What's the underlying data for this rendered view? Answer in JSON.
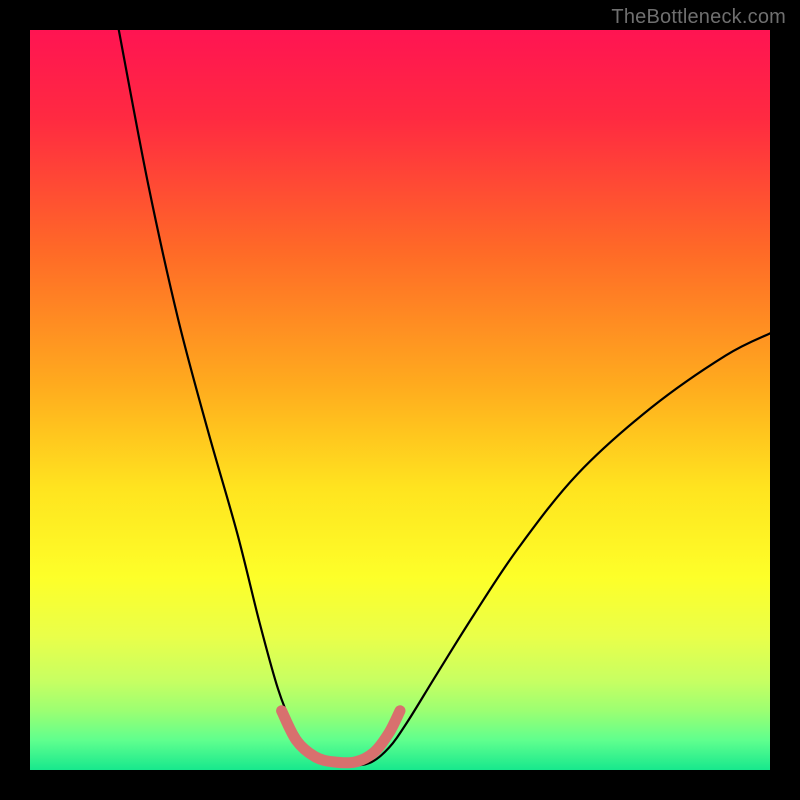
{
  "watermark": "TheBottleneck.com",
  "chart_data": {
    "type": "line",
    "title": "",
    "xlabel": "",
    "ylabel": "",
    "xlim": [
      0,
      100
    ],
    "ylim": [
      0,
      100
    ],
    "grid": false,
    "legend": false,
    "notes": "Background is a vertical color ramp from red (top) through orange/yellow to green (bottom). Two black curves descend from top-left and rise toward upper-right, meeting at a flat valley near the bottom. A short coral-pink line overlays the valley. Axes are unlabeled.",
    "background_gradient_stops": [
      {
        "offset": 0.0,
        "color": "#ff1452"
      },
      {
        "offset": 0.12,
        "color": "#ff2a41"
      },
      {
        "offset": 0.3,
        "color": "#ff6a27"
      },
      {
        "offset": 0.48,
        "color": "#ffab1e"
      },
      {
        "offset": 0.62,
        "color": "#ffe41f"
      },
      {
        "offset": 0.74,
        "color": "#fdff29"
      },
      {
        "offset": 0.82,
        "color": "#e9ff4a"
      },
      {
        "offset": 0.88,
        "color": "#c7ff62"
      },
      {
        "offset": 0.92,
        "color": "#9cff72"
      },
      {
        "offset": 0.96,
        "color": "#5fff8e"
      },
      {
        "offset": 1.0,
        "color": "#17e88d"
      }
    ],
    "series": [
      {
        "name": "left-curve",
        "values": [
          {
            "x": 12,
            "y": 100
          },
          {
            "x": 16,
            "y": 79
          },
          {
            "x": 20,
            "y": 61
          },
          {
            "x": 24,
            "y": 46
          },
          {
            "x": 28,
            "y": 32
          },
          {
            "x": 31,
            "y": 20
          },
          {
            "x": 33.5,
            "y": 11
          },
          {
            "x": 35.5,
            "y": 6
          },
          {
            "x": 37.5,
            "y": 3
          },
          {
            "x": 40,
            "y": 1
          }
        ]
      },
      {
        "name": "valley-floor",
        "values": [
          {
            "x": 40,
            "y": 1
          },
          {
            "x": 43,
            "y": 0.6
          },
          {
            "x": 46,
            "y": 1
          }
        ]
      },
      {
        "name": "right-curve",
        "values": [
          {
            "x": 46,
            "y": 1
          },
          {
            "x": 48.5,
            "y": 3
          },
          {
            "x": 51,
            "y": 6.5
          },
          {
            "x": 55,
            "y": 13
          },
          {
            "x": 60,
            "y": 21
          },
          {
            "x": 66,
            "y": 30
          },
          {
            "x": 74,
            "y": 40
          },
          {
            "x": 84,
            "y": 49
          },
          {
            "x": 94,
            "y": 56
          },
          {
            "x": 100,
            "y": 59
          }
        ]
      },
      {
        "name": "highlight-segment",
        "color": "#d8706e",
        "values": [
          {
            "x": 34,
            "y": 8
          },
          {
            "x": 36,
            "y": 4
          },
          {
            "x": 38.5,
            "y": 1.8
          },
          {
            "x": 41,
            "y": 1.1
          },
          {
            "x": 44,
            "y": 1.1
          },
          {
            "x": 46.5,
            "y": 2.4
          },
          {
            "x": 48.5,
            "y": 5
          },
          {
            "x": 50,
            "y": 8
          }
        ]
      }
    ]
  }
}
